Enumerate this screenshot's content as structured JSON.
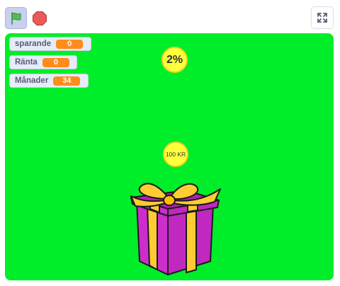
{
  "toolbar": {
    "green_flag_icon": "green-flag-icon",
    "stop_icon": "stop-icon",
    "fullscreen_icon": "fullscreen-icon"
  },
  "stage": {
    "background_color": "#00ee2a",
    "monitors": [
      {
        "label": "sparande",
        "value": "0"
      },
      {
        "label": "Ränta",
        "value": "0"
      },
      {
        "label": "Månader",
        "value": "34"
      }
    ],
    "rate_coin_text": "2%",
    "money_coin_text": "100 KR"
  },
  "colors": {
    "monitor_value": "#ff8c1a",
    "coin": "#ffff3c",
    "gift_box": "#cc2ecc",
    "gift_ribbon": "#ffcc33"
  }
}
